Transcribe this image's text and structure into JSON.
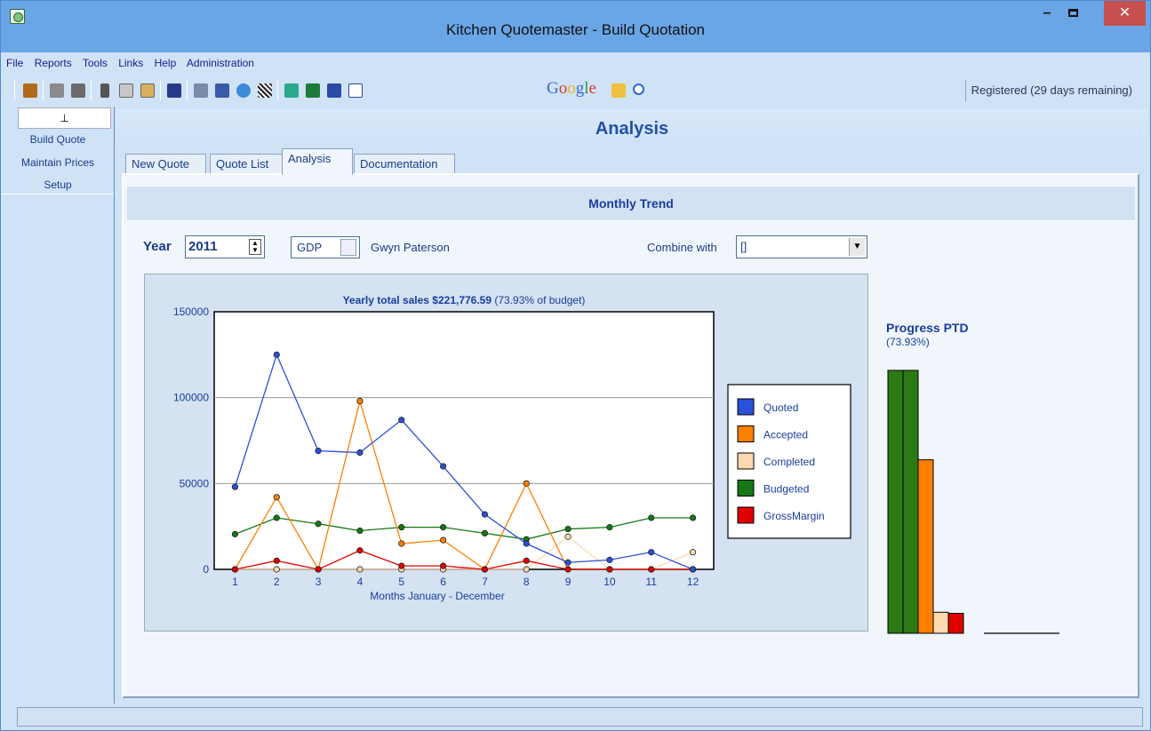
{
  "window": {
    "title": "Kitchen Quotemaster - Build Quotation"
  },
  "menu": {
    "items": [
      "File",
      "Reports",
      "Tools",
      "Links",
      "Help",
      "Administration"
    ]
  },
  "toolbar": {
    "google_label": "Google",
    "registration_status": "Registered (29 days remaining)"
  },
  "sidebar": {
    "items": [
      "Build Quote",
      "Maintain Prices",
      "Setup"
    ]
  },
  "page": {
    "title": "Analysis"
  },
  "tabs": [
    "New Quote",
    "Quote List",
    "Analysis",
    "Documentation"
  ],
  "panel": {
    "header": "Monthly Trend",
    "year_label": "Year",
    "year_value": "2011",
    "user_code": "GDP",
    "user_name": "Gwyn Paterson",
    "combine_label": "Combine with",
    "combine_value": "[]"
  },
  "progress": {
    "title": "Progress PTD",
    "percent_text": "(73.93%)",
    "colors": [
      "#2d7a12",
      "#2d7a12",
      "#ff8000",
      "#fcd9b0",
      "#e00000"
    ],
    "values": [
      125000,
      125000,
      82500,
      10000,
      9500
    ]
  },
  "chart_data": {
    "type": "line",
    "title": "Yearly total sales $221,776.59",
    "subtitle": "(73.93% of budget)",
    "xlabel": "Months  January - December",
    "ylabel": "",
    "x": [
      1,
      2,
      3,
      4,
      5,
      6,
      7,
      8,
      9,
      10,
      11,
      12
    ],
    "ylim": [
      0,
      150000
    ],
    "yticks": [
      0,
      50000,
      100000,
      150000
    ],
    "grid": true,
    "legend_position": "right",
    "series": [
      {
        "name": "Quoted",
        "color": "#2b50d8",
        "values": [
          48000,
          125000,
          69000,
          68000,
          87000,
          60000,
          32000,
          15000,
          4000,
          5500,
          10000,
          0
        ]
      },
      {
        "name": "Accepted",
        "color": "#ff8000",
        "values": [
          0,
          42000,
          0,
          98000,
          15000,
          17000,
          0,
          50000,
          0,
          0,
          0,
          0
        ]
      },
      {
        "name": "Completed",
        "color": "#fcd9b0",
        "values": [
          0,
          0,
          0,
          0,
          0,
          0,
          0,
          0,
          19000,
          0,
          0,
          10000
        ]
      },
      {
        "name": "Budgeted",
        "color": "#147814",
        "values": [
          20500,
          30000,
          26500,
          22500,
          24500,
          24500,
          21000,
          17500,
          23500,
          24500,
          30000,
          30000
        ]
      },
      {
        "name": "GrossMargin",
        "color": "#e00000",
        "values": [
          0,
          5000,
          0,
          11000,
          2000,
          2000,
          0,
          5000,
          0,
          0,
          0,
          0
        ]
      }
    ]
  }
}
